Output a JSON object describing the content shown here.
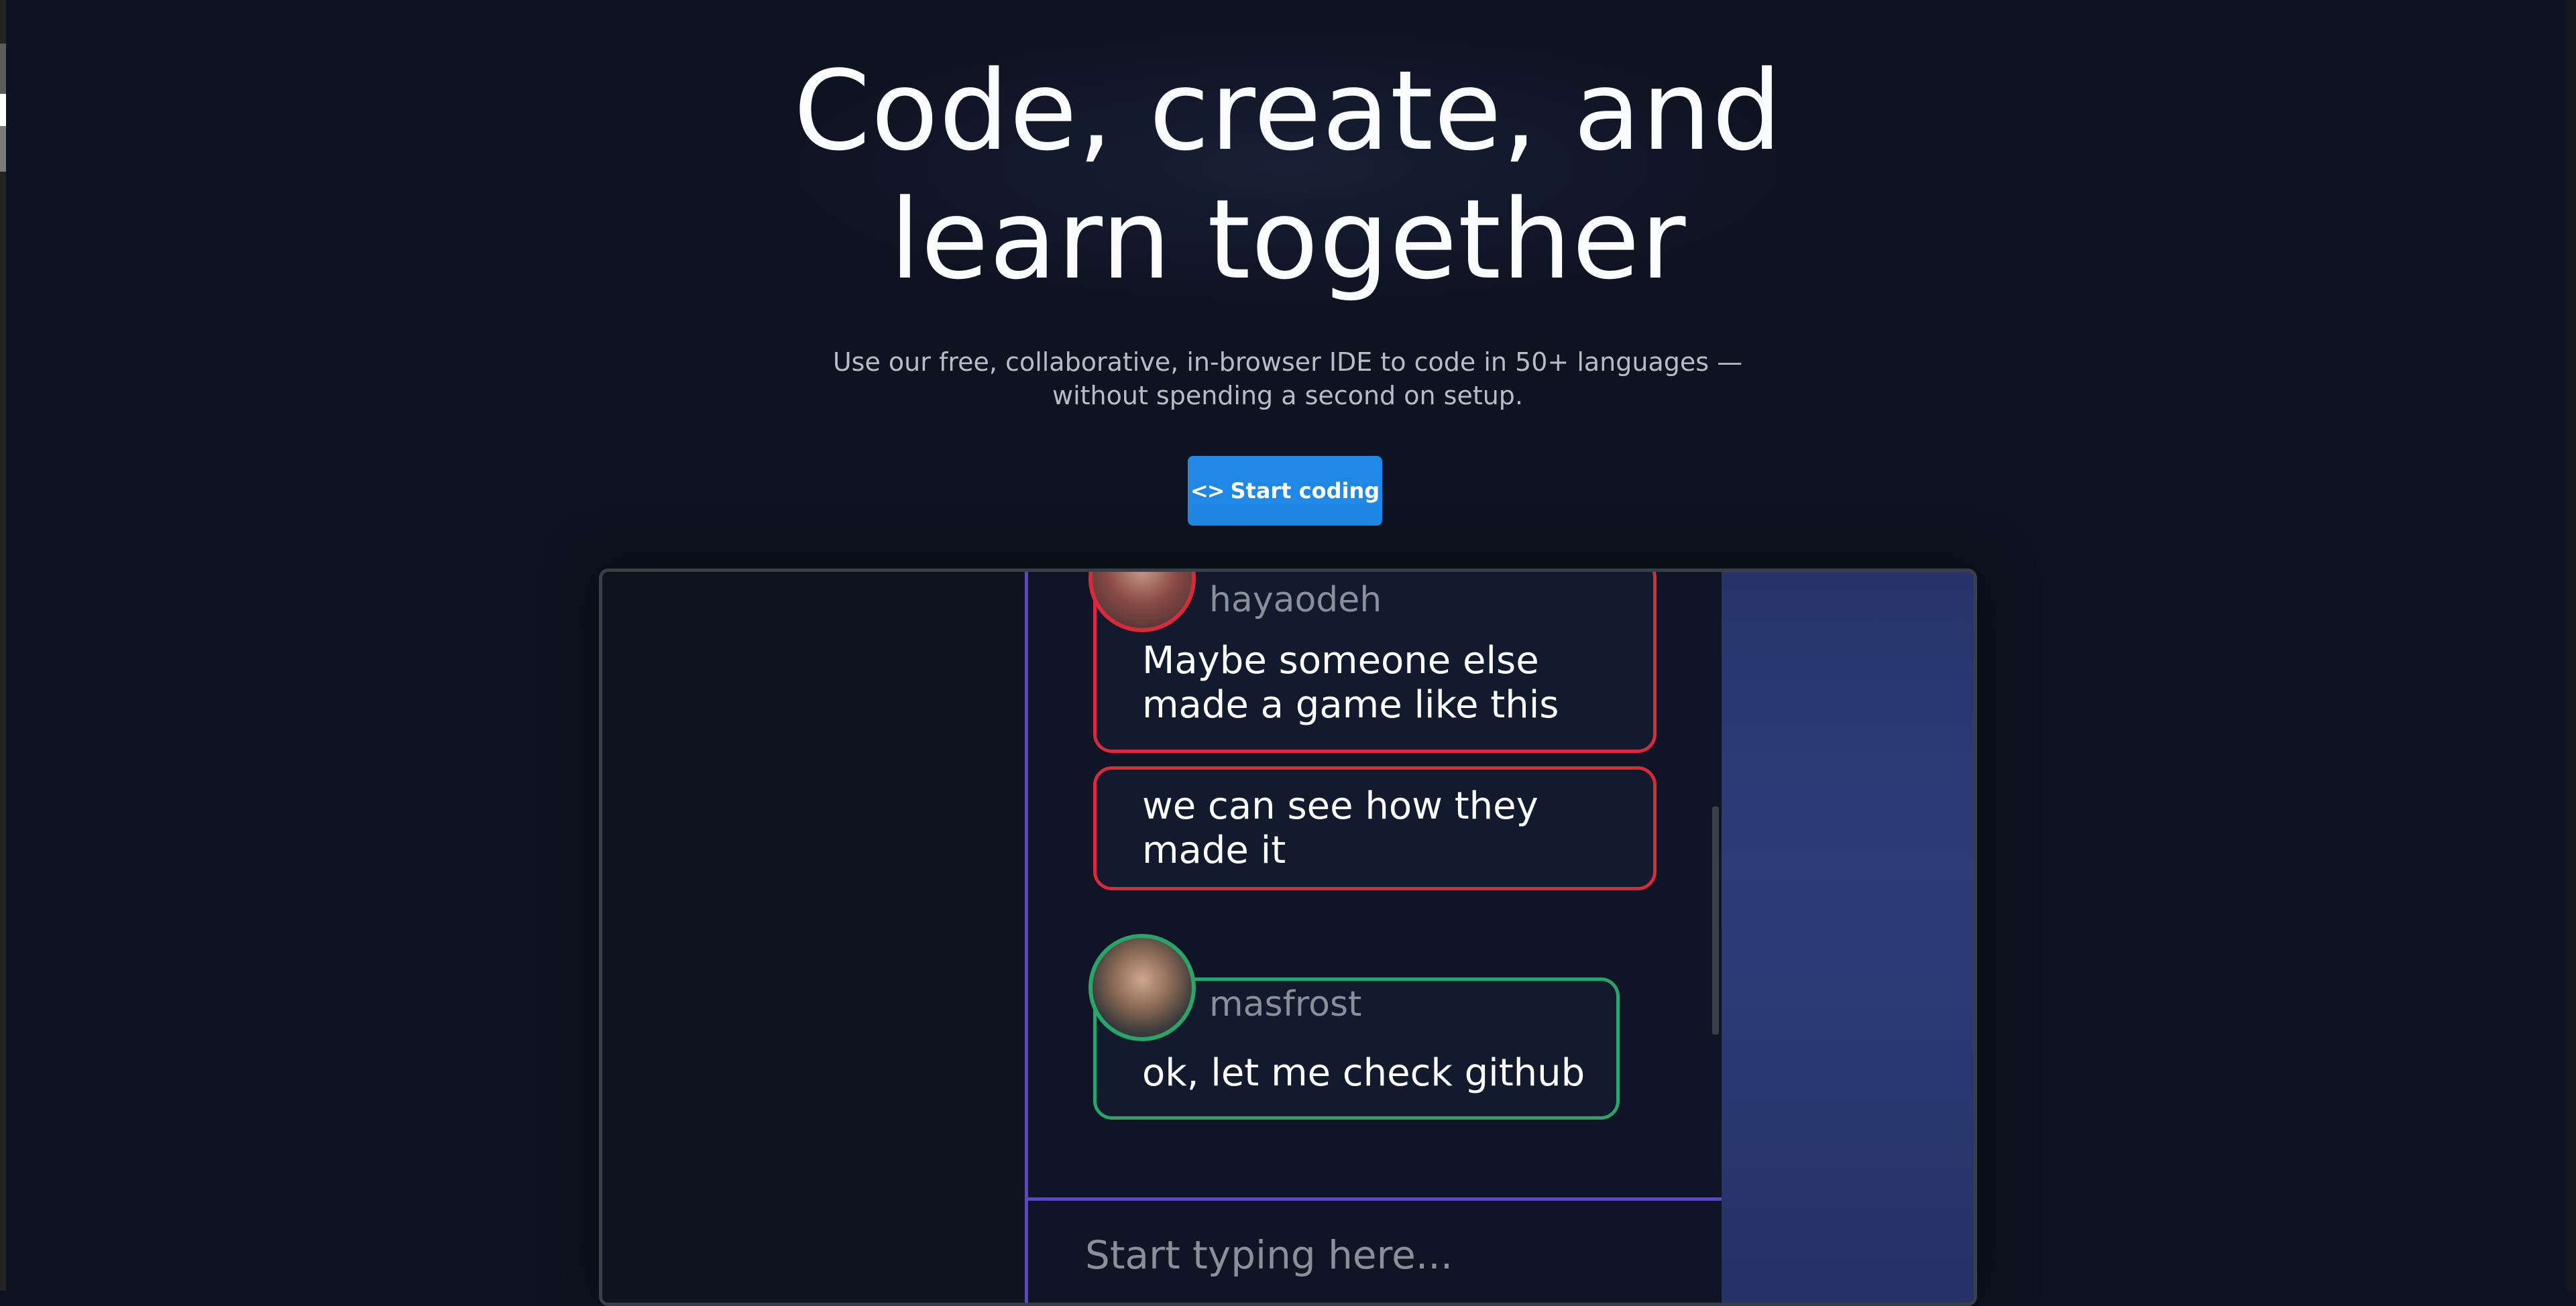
{
  "hero": {
    "headline_line1": "Code, create, and",
    "headline_line2": "learn together",
    "subtitle": "Use our free, collaborative, in-browser IDE to code in 50+ languages — without spending a second on setup.",
    "cta": {
      "icon": "code-icon",
      "icon_glyph": "<>",
      "label": "Start coding"
    }
  },
  "demo_chat": {
    "messages": [
      {
        "username": "hayaodeh",
        "avatar": "avatar-hayaodeh",
        "color": "#d62b3b",
        "texts": [
          "Maybe someone else made a game like this",
          "we can see how they made it"
        ]
      },
      {
        "username": "masfrost",
        "avatar": "avatar-masfrost",
        "color": "#2aa56a",
        "texts": [
          "ok, let me check github"
        ]
      }
    ],
    "composer_placeholder": "Start typing here..."
  },
  "colors": {
    "background": "#0e1321",
    "accent_button": "#1f88e5",
    "panel_border": "#5b4ab6"
  }
}
